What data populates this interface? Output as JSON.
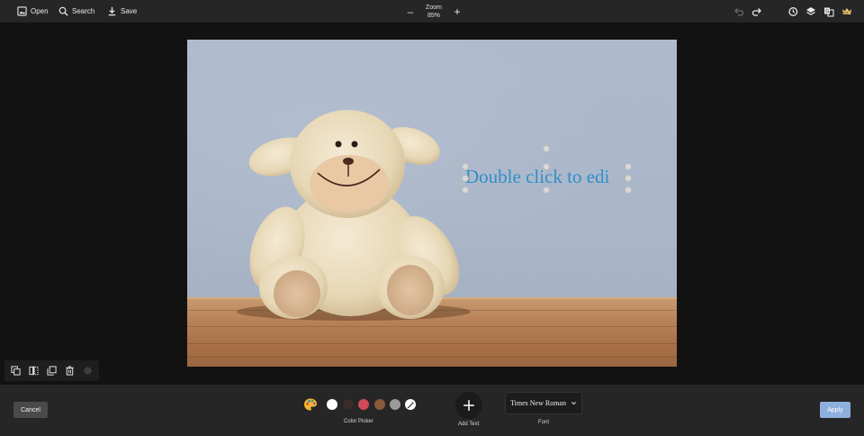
{
  "toolbar": {
    "open_label": "Open",
    "search_label": "Search",
    "save_label": "Save",
    "zoom_label": "Zoom",
    "zoom_value": "85%",
    "zoom_out": "–",
    "zoom_in": "+",
    "right_icons": [
      "undo-icon",
      "redo-icon",
      "history-icon",
      "layers-icon",
      "translate-icon",
      "vip-icon"
    ]
  },
  "canvas": {
    "image_subject": "teddy-lamb-plush-photo",
    "text_layer": "Double click to edi",
    "text_color": "#2f8fc8"
  },
  "mini_toolbar": {
    "icons": [
      "duplicate-icon",
      "flip-icon",
      "copy-icon",
      "delete-icon",
      "settings-icon"
    ]
  },
  "bottom": {
    "cancel_label": "Cancel",
    "apply_label": "Apply",
    "color_picker_label": "Color Picker",
    "swatches": [
      "#ffffff",
      "#3a2a2a",
      "#d04a5a",
      "#8a5a3c",
      "#9a9a9a"
    ],
    "add_text_label": "Add Text",
    "font_value": "Times New Roman",
    "font_label": "Font"
  },
  "colors": {
    "topbar_bg": "#262626",
    "canvas_bg": "#121212",
    "apply_bg": "#8eb0dd"
  }
}
